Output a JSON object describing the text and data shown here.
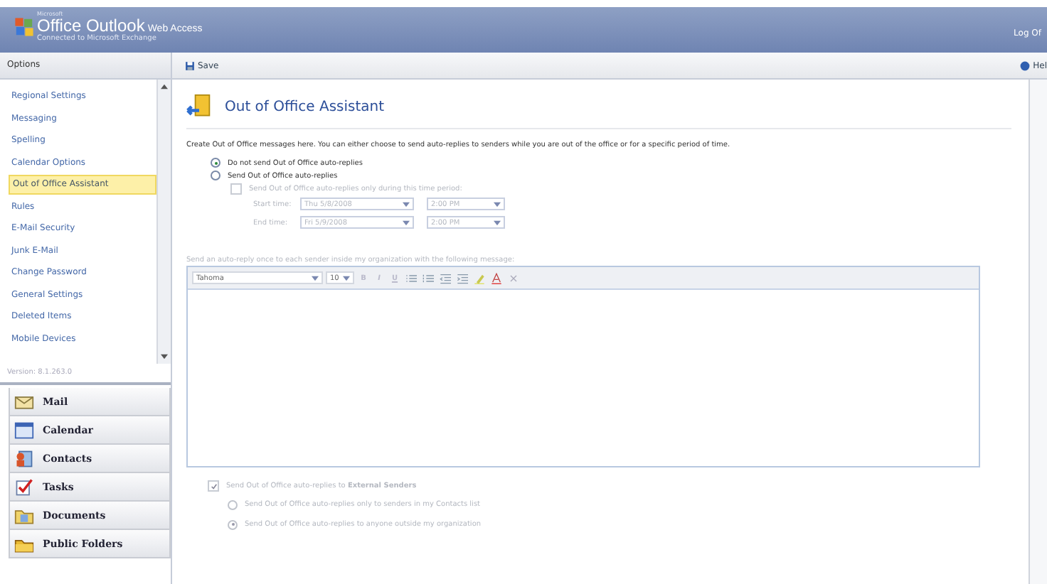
{
  "header": {
    "vendor": "Microsoft",
    "brand": "Office Outlook",
    "brand_suffix": "Web Access",
    "subtitle": "Connected to Microsoft Exchange",
    "logoff": "Log Of"
  },
  "sidebar": {
    "title": "Options",
    "items": [
      {
        "label": "Regional Settings",
        "selected": false
      },
      {
        "label": "Messaging",
        "selected": false
      },
      {
        "label": "Spelling",
        "selected": false
      },
      {
        "label": "Calendar Options",
        "selected": false
      },
      {
        "label": "Out of Office Assistant",
        "selected": true
      },
      {
        "label": "Rules",
        "selected": false
      },
      {
        "label": "E-Mail Security",
        "selected": false
      },
      {
        "label": "Junk E-Mail",
        "selected": false
      },
      {
        "label": "Change Password",
        "selected": false
      },
      {
        "label": "General Settings",
        "selected": false
      },
      {
        "label": "Deleted Items",
        "selected": false
      },
      {
        "label": "Mobile Devices",
        "selected": false
      }
    ],
    "version": "Version: 8.1.263.0",
    "nav": [
      {
        "label": "Mail",
        "kind": "mail"
      },
      {
        "label": "Calendar",
        "kind": "calendar"
      },
      {
        "label": "Contacts",
        "kind": "contacts"
      },
      {
        "label": "Tasks",
        "kind": "tasks"
      },
      {
        "label": "Documents",
        "kind": "documents"
      },
      {
        "label": "Public Folders",
        "kind": "folders"
      }
    ]
  },
  "toolbar": {
    "save": "Save",
    "help": "Hel"
  },
  "content": {
    "title": "Out of Office Assistant",
    "intro": "Create Out of Office messages here. You can either choose to send auto-replies to senders while you are out of the office or for a specific period of time.",
    "modes": [
      {
        "label": "Do not send Out of Office auto-replies",
        "selected": true
      },
      {
        "label": "Send Out of Office auto-replies",
        "selected": false
      }
    ],
    "period": {
      "label": "Send Out of Office auto-replies only during this time period:",
      "checked": false,
      "disabled": true,
      "rows": [
        {
          "label": "Start time:",
          "date": "Thu 5/8/2008",
          "time": "2:00 PM"
        },
        {
          "label": "End time:",
          "date": "Fri 5/9/2008",
          "time": "2:00 PM"
        }
      ]
    },
    "message": {
      "label": "Send an auto-reply once to each sender inside my organization with the following message:",
      "disabled": true,
      "font": "Tahoma",
      "size": "10",
      "format_buttons": [
        "B",
        "I",
        "U"
      ]
    },
    "external": {
      "label": "Send Out of Office auto-replies to **External Senders**",
      "checked": true,
      "disabled": true,
      "options": [
        {
          "label": "Send Out of Office auto-replies only to senders in my Contacts list",
          "selected": false
        },
        {
          "label": "Send Out of Office auto-replies to anyone outside my organization",
          "selected": true
        }
      ]
    }
  }
}
